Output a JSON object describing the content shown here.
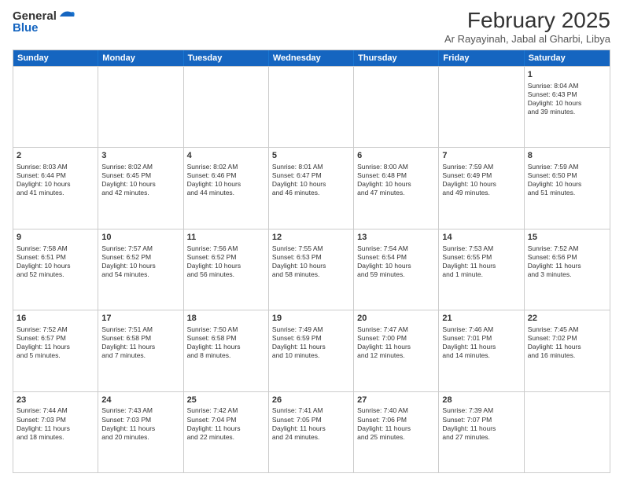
{
  "header": {
    "logo_general": "General",
    "logo_blue": "Blue",
    "month_title": "February 2025",
    "subtitle": "Ar Rayayinah, Jabal al Gharbi, Libya"
  },
  "weekdays": [
    "Sunday",
    "Monday",
    "Tuesday",
    "Wednesday",
    "Thursday",
    "Friday",
    "Saturday"
  ],
  "rows": [
    [
      {
        "day": "",
        "text": ""
      },
      {
        "day": "",
        "text": ""
      },
      {
        "day": "",
        "text": ""
      },
      {
        "day": "",
        "text": ""
      },
      {
        "day": "",
        "text": ""
      },
      {
        "day": "",
        "text": ""
      },
      {
        "day": "1",
        "text": "Sunrise: 8:04 AM\nSunset: 6:43 PM\nDaylight: 10 hours\nand 39 minutes."
      }
    ],
    [
      {
        "day": "2",
        "text": "Sunrise: 8:03 AM\nSunset: 6:44 PM\nDaylight: 10 hours\nand 41 minutes."
      },
      {
        "day": "3",
        "text": "Sunrise: 8:02 AM\nSunset: 6:45 PM\nDaylight: 10 hours\nand 42 minutes."
      },
      {
        "day": "4",
        "text": "Sunrise: 8:02 AM\nSunset: 6:46 PM\nDaylight: 10 hours\nand 44 minutes."
      },
      {
        "day": "5",
        "text": "Sunrise: 8:01 AM\nSunset: 6:47 PM\nDaylight: 10 hours\nand 46 minutes."
      },
      {
        "day": "6",
        "text": "Sunrise: 8:00 AM\nSunset: 6:48 PM\nDaylight: 10 hours\nand 47 minutes."
      },
      {
        "day": "7",
        "text": "Sunrise: 7:59 AM\nSunset: 6:49 PM\nDaylight: 10 hours\nand 49 minutes."
      },
      {
        "day": "8",
        "text": "Sunrise: 7:59 AM\nSunset: 6:50 PM\nDaylight: 10 hours\nand 51 minutes."
      }
    ],
    [
      {
        "day": "9",
        "text": "Sunrise: 7:58 AM\nSunset: 6:51 PM\nDaylight: 10 hours\nand 52 minutes."
      },
      {
        "day": "10",
        "text": "Sunrise: 7:57 AM\nSunset: 6:52 PM\nDaylight: 10 hours\nand 54 minutes."
      },
      {
        "day": "11",
        "text": "Sunrise: 7:56 AM\nSunset: 6:52 PM\nDaylight: 10 hours\nand 56 minutes."
      },
      {
        "day": "12",
        "text": "Sunrise: 7:55 AM\nSunset: 6:53 PM\nDaylight: 10 hours\nand 58 minutes."
      },
      {
        "day": "13",
        "text": "Sunrise: 7:54 AM\nSunset: 6:54 PM\nDaylight: 10 hours\nand 59 minutes."
      },
      {
        "day": "14",
        "text": "Sunrise: 7:53 AM\nSunset: 6:55 PM\nDaylight: 11 hours\nand 1 minute."
      },
      {
        "day": "15",
        "text": "Sunrise: 7:52 AM\nSunset: 6:56 PM\nDaylight: 11 hours\nand 3 minutes."
      }
    ],
    [
      {
        "day": "16",
        "text": "Sunrise: 7:52 AM\nSunset: 6:57 PM\nDaylight: 11 hours\nand 5 minutes."
      },
      {
        "day": "17",
        "text": "Sunrise: 7:51 AM\nSunset: 6:58 PM\nDaylight: 11 hours\nand 7 minutes."
      },
      {
        "day": "18",
        "text": "Sunrise: 7:50 AM\nSunset: 6:58 PM\nDaylight: 11 hours\nand 8 minutes."
      },
      {
        "day": "19",
        "text": "Sunrise: 7:49 AM\nSunset: 6:59 PM\nDaylight: 11 hours\nand 10 minutes."
      },
      {
        "day": "20",
        "text": "Sunrise: 7:47 AM\nSunset: 7:00 PM\nDaylight: 11 hours\nand 12 minutes."
      },
      {
        "day": "21",
        "text": "Sunrise: 7:46 AM\nSunset: 7:01 PM\nDaylight: 11 hours\nand 14 minutes."
      },
      {
        "day": "22",
        "text": "Sunrise: 7:45 AM\nSunset: 7:02 PM\nDaylight: 11 hours\nand 16 minutes."
      }
    ],
    [
      {
        "day": "23",
        "text": "Sunrise: 7:44 AM\nSunset: 7:03 PM\nDaylight: 11 hours\nand 18 minutes."
      },
      {
        "day": "24",
        "text": "Sunrise: 7:43 AM\nSunset: 7:03 PM\nDaylight: 11 hours\nand 20 minutes."
      },
      {
        "day": "25",
        "text": "Sunrise: 7:42 AM\nSunset: 7:04 PM\nDaylight: 11 hours\nand 22 minutes."
      },
      {
        "day": "26",
        "text": "Sunrise: 7:41 AM\nSunset: 7:05 PM\nDaylight: 11 hours\nand 24 minutes."
      },
      {
        "day": "27",
        "text": "Sunrise: 7:40 AM\nSunset: 7:06 PM\nDaylight: 11 hours\nand 25 minutes."
      },
      {
        "day": "28",
        "text": "Sunrise: 7:39 AM\nSunset: 7:07 PM\nDaylight: 11 hours\nand 27 minutes."
      },
      {
        "day": "",
        "text": ""
      }
    ]
  ]
}
